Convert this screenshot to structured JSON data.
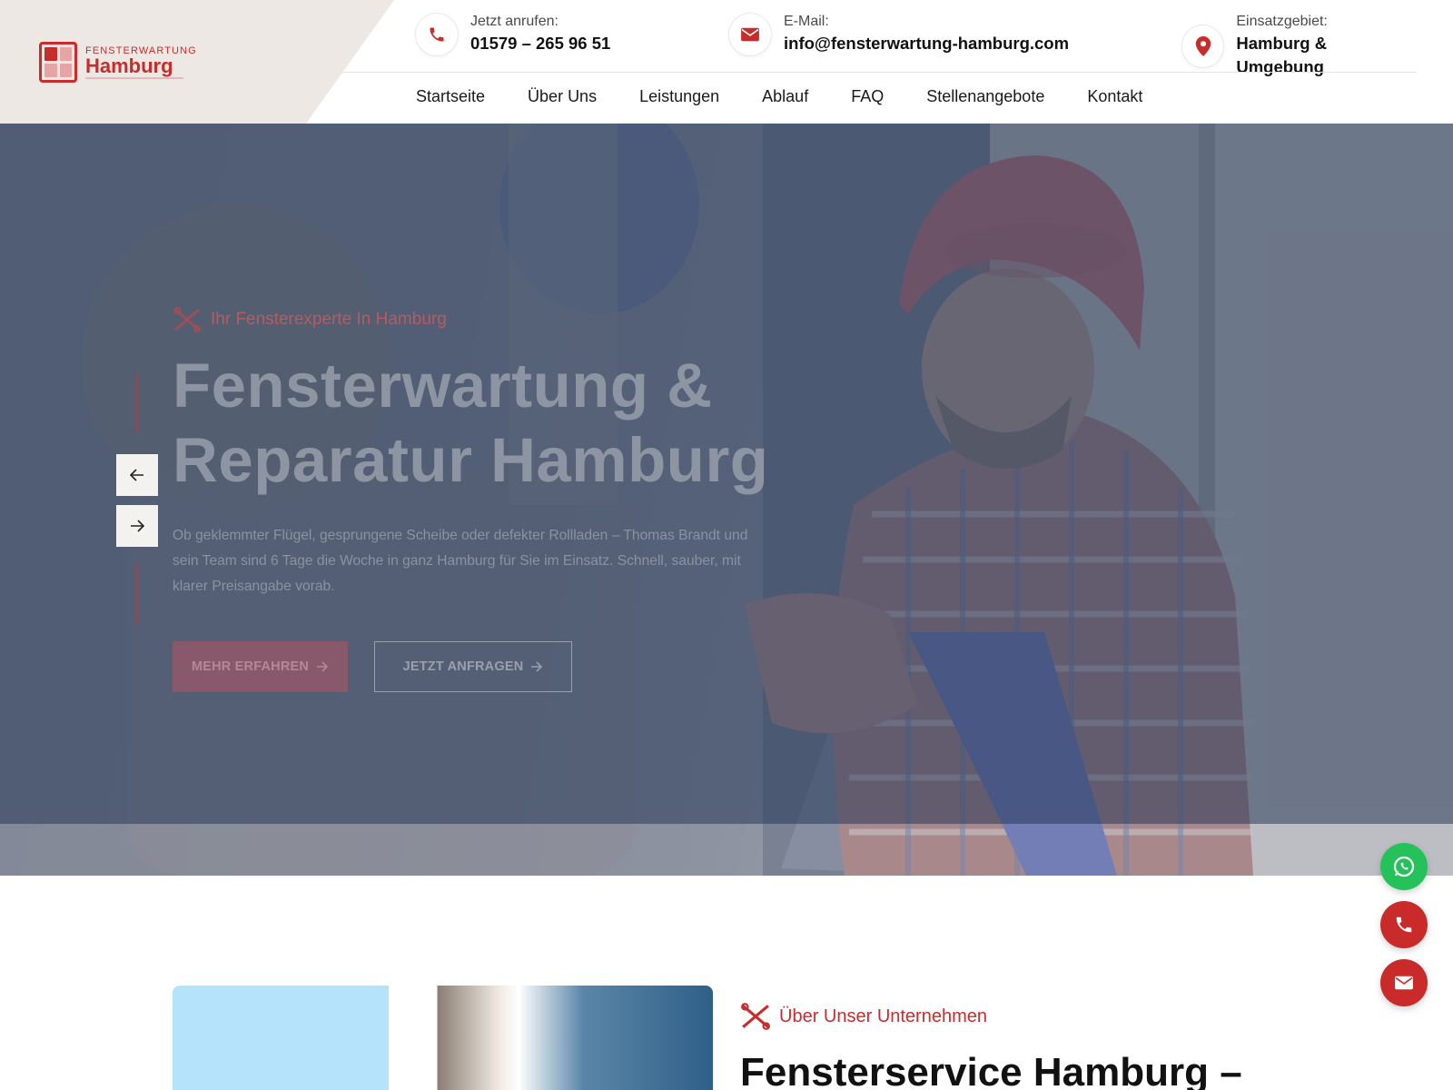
{
  "logo": {
    "small": "FENSTERWARTUNG",
    "big": "Hamburg"
  },
  "contacts": {
    "phone": {
      "label": "Jetzt anrufen:",
      "value": "01579 – 265 96 51",
      "icon": "phone-icon"
    },
    "mail": {
      "label": "E-Mail:",
      "value": "info@fensterwartung-hamburg.com",
      "icon": "envelope-icon"
    },
    "area": {
      "label": "Einsatzgebiet:",
      "value": "Hamburg & Umgebung",
      "icon": "map-pin-icon"
    }
  },
  "nav": {
    "items": [
      {
        "label": "Startseite"
      },
      {
        "label": "Über Uns"
      },
      {
        "label": "Leistungen"
      },
      {
        "label": "Ablauf"
      },
      {
        "label": "FAQ"
      },
      {
        "label": "Stellenangebote"
      },
      {
        "label": "Kontakt"
      }
    ]
  },
  "hero": {
    "tag": "Ihr Fensterexperte In Hamburg",
    "title_line1": "Fensterwartung &",
    "title_line2": "Reparatur Hamburg",
    "text": "Ob geklemmter Flügel, gesprungene Scheibe oder defekter Rollladen – Thomas Brandt und sein Team sind 6 Tage die Woche in ganz Hamburg für Sie im Einsatz. Schnell, sauber, mit klarer Preisangabe vorab.",
    "btn_more": "MEHR ERFAHREN",
    "btn_request": "JETZT ANFRAGEN"
  },
  "about": {
    "tag": "Über Unser Unternehmen",
    "title": "Fensterservice Hamburg –"
  },
  "colors": {
    "accent": "#c62d2d",
    "logo_bg": "#ede8e4",
    "whatsapp": "#25c15a"
  }
}
